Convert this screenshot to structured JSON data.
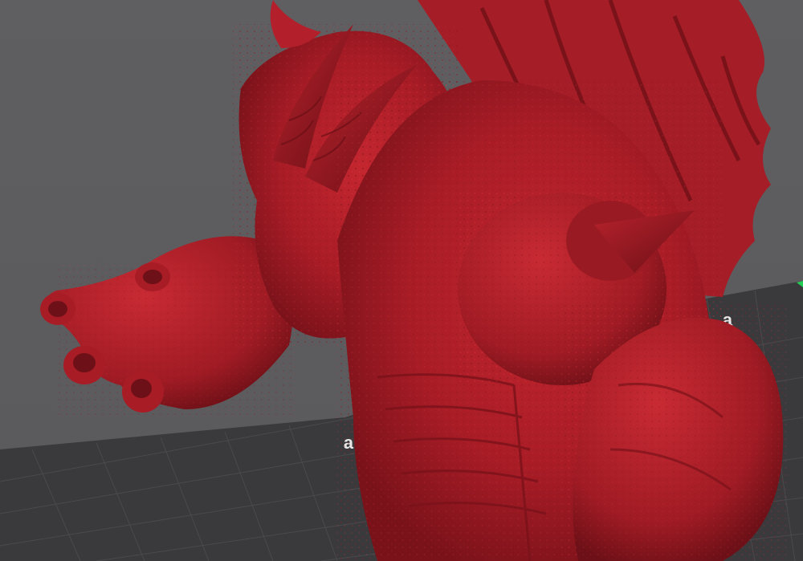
{
  "viewport": {
    "background_color": "#5c5c5e",
    "build_plate_color": "#3a3a3c",
    "grid_line_color": "#4a4a4c",
    "model_color": "#b3202b",
    "axis_indicator_color": "#22cc55"
  },
  "build_plate": {
    "label_text": "ɐ",
    "corner_label_text": "ɐ"
  },
  "model": {
    "name": "",
    "icon": "dragon-kaiju-bust"
  }
}
